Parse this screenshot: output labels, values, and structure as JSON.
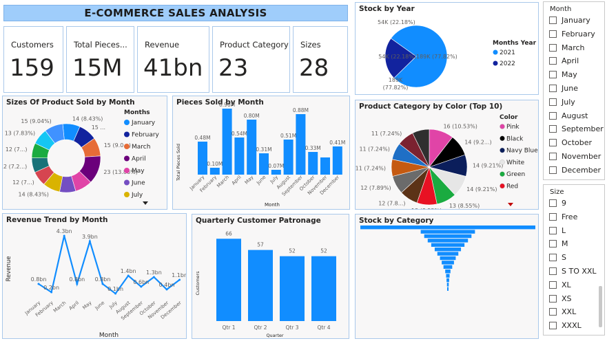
{
  "title": "E-COMMERCE SALES ANALYSIS",
  "kpis": [
    {
      "label": "Customers",
      "value": "159"
    },
    {
      "label": "Total Pieces...",
      "value": "15M"
    },
    {
      "label": "Revenue",
      "value": "41bn"
    },
    {
      "label": "Product Category",
      "value": "23"
    },
    {
      "label": "Sizes",
      "value": "28"
    }
  ],
  "month_slicer": {
    "header": "Month",
    "items": [
      "January",
      "February",
      "March",
      "April",
      "May",
      "June",
      "July",
      "August",
      "September",
      "October",
      "November",
      "December"
    ]
  },
  "size_slicer": {
    "header": "Size",
    "items": [
      "9",
      "Free",
      "L",
      "M",
      "S",
      "S TO XXL",
      "XL",
      "XS",
      "XXL",
      "XXXL"
    ]
  },
  "panels": {
    "sizes_title": "Sizes Of Product Sold by Month",
    "pieces_title": "Pieces Sold by Month",
    "stock_year_title": "Stock by Year",
    "category_color_title": "Product Category by Color (Top 10)",
    "revenue_title": "Revenue Trend by Month",
    "quarterly_title": "Quarterly Customer Patronage",
    "stock_category_title": "Stock by Category"
  },
  "colors": {
    "accent": "#118dff",
    "dark_blue": "#12239e",
    "title_banner": "#9fcdfb",
    "panel_border": "#a9c8ea"
  },
  "chart_data": [
    {
      "id": "sizes_by_month",
      "type": "pie",
      "variant": "donut",
      "legend_title": "Months",
      "legend_visible": [
        "January",
        "February",
        "March",
        "April",
        "May",
        "June",
        "July"
      ],
      "slices": [
        {
          "name": "January",
          "value": 14,
          "label": "14 (8.43%)",
          "color": "#118dff"
        },
        {
          "name": "February",
          "value": 15,
          "label": "15 ...",
          "color": "#12239e"
        },
        {
          "name": "March",
          "value": 15,
          "label": "15 (9.0...)",
          "color": "#e66c37"
        },
        {
          "name": "April",
          "value": 23,
          "label": "23 (13.86%)",
          "color": "#6b007b"
        },
        {
          "name": "May",
          "value": 14,
          "label": "",
          "color": "#e044a7"
        },
        {
          "name": "June",
          "value": 13,
          "label": "",
          "color": "#744ec2"
        },
        {
          "name": "July",
          "value": 14,
          "label": "14 (8.43%)",
          "color": "#d9b300"
        },
        {
          "name": "August",
          "value": 12,
          "label": "12 (7...)",
          "color": "#d64550"
        },
        {
          "name": "September",
          "value": 12,
          "label": "12 (7.2...)",
          "color": "#197278"
        },
        {
          "name": "October",
          "value": 12,
          "label": "12 (7...)",
          "color": "#1aab40"
        },
        {
          "name": "November",
          "value": 13,
          "label": "13 (7.83%)",
          "color": "#15c6f4"
        },
        {
          "name": "December",
          "value": 15,
          "label": "15 (9.04%)",
          "color": "#4092ff"
        }
      ]
    },
    {
      "id": "pieces_by_month",
      "type": "bar",
      "ylabel": "Total Pieces Sold",
      "xlabel": "Month",
      "categories": [
        "January",
        "February",
        "March",
        "April",
        "May",
        "June",
        "July",
        "August",
        "September",
        "October",
        "November",
        "December"
      ],
      "values": [
        0.48,
        0.1,
        0.96,
        0.54,
        0.8,
        0.31,
        0.07,
        0.51,
        0.88,
        0.33,
        0.25,
        0.41
      ],
      "data_labels": [
        "0.48M",
        "0.10M",
        "0.96M",
        "0.54M",
        "0.80M",
        "0.31M",
        "0.07M",
        "0.51M",
        "0.88M",
        "0.33M",
        "",
        "0.41M"
      ],
      "ylim": [
        0,
        1.0
      ]
    },
    {
      "id": "stock_by_year",
      "type": "pie",
      "legend_title": "Months Year",
      "slices": [
        {
          "name": "2021",
          "value": 189,
          "label": "189K (77.82%)",
          "color": "#118dff"
        },
        {
          "name": "2022",
          "value": 54,
          "label": "54K (22.18%)",
          "color": "#12239e"
        }
      ]
    },
    {
      "id": "category_by_color",
      "type": "pie",
      "legend_title": "Color",
      "legend_visible": [
        "Pink",
        "Black",
        "Navy Blue",
        "White",
        "Green",
        "Red"
      ],
      "slices": [
        {
          "name": "Pink",
          "value": 16,
          "label": "16 (10.53%)",
          "color": "#e044a7"
        },
        {
          "name": "Black",
          "value": 14,
          "label": "14 (9.2...)",
          "color": "#000000"
        },
        {
          "name": "Navy Blue",
          "value": 14,
          "label": "14 (9.21%)",
          "color": "#0b1e5b"
        },
        {
          "name": "White",
          "value": 14,
          "label": "14 (9.21%)",
          "color": "#e6e6e6"
        },
        {
          "name": "Green",
          "value": 13,
          "label": "13 (8.55%)",
          "color": "#1aab40"
        },
        {
          "name": "Red",
          "value": 13,
          "label": "13 (8.55%)",
          "color": "#e81123"
        },
        {
          "name": "Brown",
          "value": 12,
          "label": "12 (7.8...)",
          "color": "#5c3317"
        },
        {
          "name": "Grey",
          "value": 12,
          "label": "12 (7.89%)",
          "color": "#6b6b6b"
        },
        {
          "name": "Orange",
          "value": 11,
          "label": "11 (7.24%)",
          "color": "#c55a11"
        },
        {
          "name": "Blue",
          "value": 11,
          "label": "11 (7.24%)",
          "color": "#1f6fc5"
        },
        {
          "name": "Maroon",
          "value": 11,
          "label": "11 (7.24%)",
          "color": "#7b2230"
        },
        {
          "name": "Charcoal",
          "value": 11,
          "label": "",
          "color": "#2f2f2f"
        }
      ]
    },
    {
      "id": "revenue_trend",
      "type": "line",
      "xlabel": "Month",
      "ylabel": "Revenue",
      "categories": [
        "January",
        "February",
        "March",
        "April",
        "May",
        "June",
        "July",
        "August",
        "September",
        "October",
        "November",
        "December"
      ],
      "values": [
        0.8,
        0.2,
        4.3,
        0.8,
        3.9,
        0.8,
        0.1,
        1.4,
        0.6,
        1.3,
        0.4,
        1.1
      ],
      "data_labels": [
        "0.8bn",
        "0.2bn",
        "4.3bn",
        "0.8bn",
        "3.9bn",
        "0.8bn",
        "0.1bn",
        "1.4bn",
        "0.6bn",
        "1.3bn",
        "0.4bn",
        "1.1bn"
      ],
      "ylim": [
        0,
        4.5
      ]
    },
    {
      "id": "quarterly_patronage",
      "type": "bar",
      "xlabel": "Quarter",
      "ylabel": "Customers",
      "categories": [
        "Qtr 1",
        "Qtr 2",
        "Qtr 3",
        "Qtr 4"
      ],
      "values": [
        66,
        57,
        52,
        52
      ],
      "ylim": [
        0,
        70
      ]
    },
    {
      "id": "stock_by_category",
      "type": "bar",
      "variant": "funnel",
      "values": [
        100,
        31,
        27,
        23,
        19,
        15,
        12,
        9,
        7,
        5,
        3,
        2,
        1.5,
        1,
        0.6
      ]
    }
  ]
}
